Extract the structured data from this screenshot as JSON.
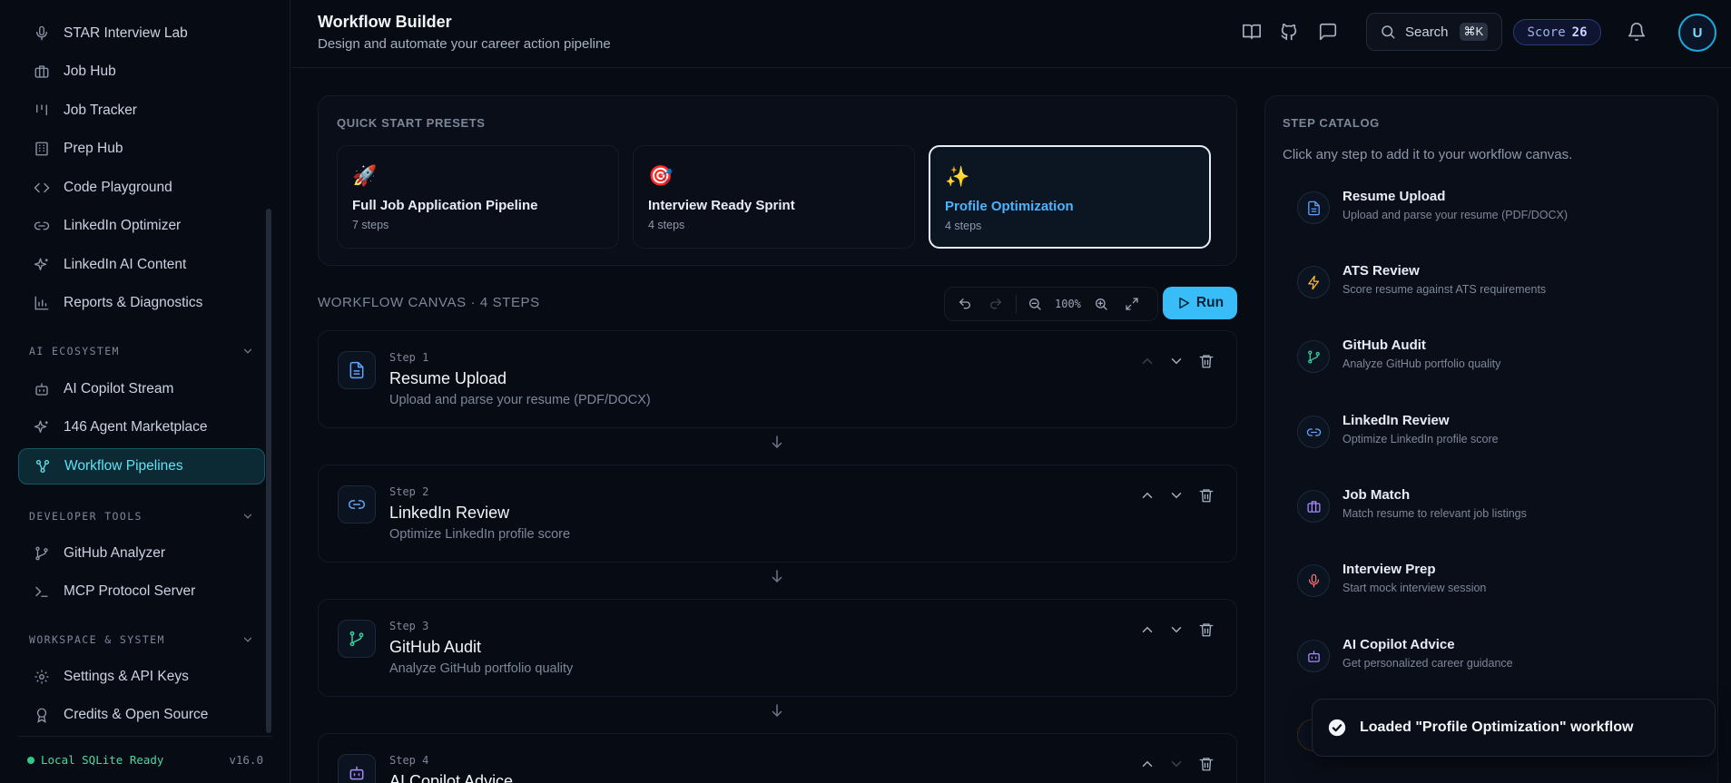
{
  "sidebar": {
    "items_top": [
      {
        "label": "STAR Interview Lab",
        "icon": "microphone-icon"
      },
      {
        "label": "Job Hub",
        "icon": "briefcase-icon"
      },
      {
        "label": "Job Tracker",
        "icon": "kanban-icon"
      },
      {
        "label": "Prep Hub",
        "icon": "building-icon"
      },
      {
        "label": "Code Playground",
        "icon": "code-icon"
      },
      {
        "label": "LinkedIn Optimizer",
        "icon": "link-icon"
      },
      {
        "label": "LinkedIn AI Content",
        "icon": "sparkles-icon"
      },
      {
        "label": "Reports & Diagnostics",
        "icon": "bar-chart-icon"
      }
    ],
    "sections": [
      {
        "title": "AI ECOSYSTEM",
        "items": [
          {
            "label": "AI Copilot Stream",
            "icon": "bot-icon"
          },
          {
            "label": "146 Agent Marketplace",
            "icon": "sparkles-icon"
          },
          {
            "label": "Workflow Pipelines",
            "icon": "workflow-icon",
            "active": true
          }
        ]
      },
      {
        "title": "DEVELOPER TOOLS",
        "items": [
          {
            "label": "GitHub Analyzer",
            "icon": "git-branch-icon"
          },
          {
            "label": "MCP Protocol Server",
            "icon": "terminal-icon"
          }
        ]
      },
      {
        "title": "WORKSPACE & SYSTEM",
        "items": [
          {
            "label": "Settings & API Keys",
            "icon": "gear-icon"
          },
          {
            "label": "Credits & Open Source",
            "icon": "award-icon"
          }
        ]
      }
    ],
    "status": "Local SQLite Ready",
    "version": "v16.0"
  },
  "header": {
    "title": "Workflow Builder",
    "subtitle": "Design and automate your career action pipeline",
    "search_label": "Search",
    "search_kbd": "⌘K",
    "score_label": "Score",
    "score_value": "26",
    "avatar_initial": "U"
  },
  "presets": {
    "label": "QUICK START PRESETS",
    "items": [
      {
        "emoji": "🚀",
        "name": "Full Job Application Pipeline",
        "steps": "7 steps"
      },
      {
        "emoji": "🎯",
        "name": "Interview Ready Sprint",
        "steps": "4 steps"
      },
      {
        "emoji": "✨",
        "name": "Profile Optimization",
        "steps": "4 steps",
        "selected": true
      }
    ]
  },
  "canvas": {
    "title": "WORKFLOW CANVAS · 4 STEPS",
    "zoom": "100%",
    "run_label": "Run",
    "steps": [
      {
        "num": "Step 1",
        "title": "Resume Upload",
        "desc": "Upload and parse your resume (PDF/DOCX)",
        "icon": "document-icon",
        "color": "#60a5fa"
      },
      {
        "num": "Step 2",
        "title": "LinkedIn Review",
        "desc": "Optimize LinkedIn profile score",
        "icon": "link-icon",
        "color": "#60a5fa"
      },
      {
        "num": "Step 3",
        "title": "GitHub Audit",
        "desc": "Analyze GitHub portfolio quality",
        "icon": "git-branch-icon",
        "color": "#34d399"
      },
      {
        "num": "Step 4",
        "title": "AI Copilot Advice",
        "desc": "",
        "icon": "bot-icon",
        "color": "#a78bfa"
      }
    ]
  },
  "catalog": {
    "label": "STEP CATALOG",
    "description": "Click any step to add it to your workflow canvas.",
    "items": [
      {
        "title": "Resume Upload",
        "desc": "Upload and parse your resume (PDF/DOCX)",
        "icon": "document-icon",
        "color": "#60a5fa"
      },
      {
        "title": "ATS Review",
        "desc": "Score resume against ATS requirements",
        "icon": "lightning-icon",
        "color": "#fbbf24"
      },
      {
        "title": "GitHub Audit",
        "desc": "Analyze GitHub portfolio quality",
        "icon": "git-branch-icon",
        "color": "#34d399"
      },
      {
        "title": "LinkedIn Review",
        "desc": "Optimize LinkedIn profile score",
        "icon": "link-icon",
        "color": "#60a5fa"
      },
      {
        "title": "Job Match",
        "desc": "Match resume to relevant job listings",
        "icon": "briefcase-icon",
        "color": "#a78bfa"
      },
      {
        "title": "Interview Prep",
        "desc": "Start mock interview session",
        "icon": "microphone-icon",
        "color": "#f87171"
      },
      {
        "title": "AI Copilot Advice",
        "desc": "Get personalized career guidance",
        "icon": "bot-icon",
        "color": "#a78bfa"
      }
    ]
  },
  "toast": {
    "message": "Loaded \"Profile Optimization\" workflow",
    "icon": "check-circle-icon"
  }
}
